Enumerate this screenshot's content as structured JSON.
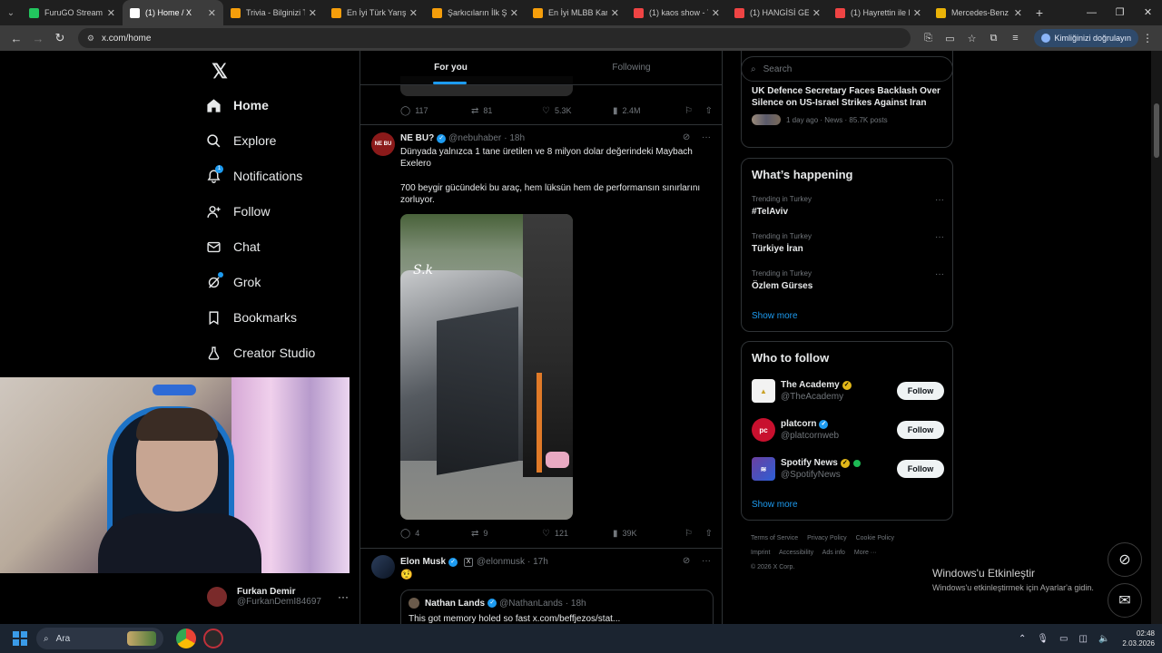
{
  "browser": {
    "tabs": [
      {
        "title": "FuruGO Stream - Y",
        "color": "#22c55e",
        "active": false
      },
      {
        "title": "(1) Home / X",
        "color": "#ffffff",
        "active": true
      },
      {
        "title": "Trivia - Bilginizi Te",
        "color": "#f59e0b",
        "active": false
      },
      {
        "title": "En İyi Türk Yarışm",
        "color": "#f59e0b",
        "active": false
      },
      {
        "title": "Şarkıcıların İlk Şa",
        "color": "#f59e0b",
        "active": false
      },
      {
        "title": "En İyi MLBB Karak",
        "color": "#f59e0b",
        "active": false
      },
      {
        "title": "(1) kaos show - Yo",
        "color": "#ef4444",
        "active": false
      },
      {
        "title": "(1) HANGİSİ GERÇ",
        "color": "#ef4444",
        "active": false
      },
      {
        "title": "(1) Hayrettin ile K",
        "color": "#ef4444",
        "active": false
      },
      {
        "title": "Mercedes-Benz /",
        "color": "#eab308",
        "active": false
      }
    ],
    "url": "x.com/home",
    "verify_label": "Kimliğinizi doğrulayın"
  },
  "nav": {
    "items": [
      {
        "label": "Home",
        "icon": "home-icon"
      },
      {
        "label": "Explore",
        "icon": "search-icon"
      },
      {
        "label": "Notifications",
        "icon": "bell-icon",
        "badge": "1"
      },
      {
        "label": "Follow",
        "icon": "person-plus-icon"
      },
      {
        "label": "Chat",
        "icon": "mail-icon"
      },
      {
        "label": "Grok",
        "icon": "grok-icon"
      },
      {
        "label": "Bookmarks",
        "icon": "bookmark-icon"
      },
      {
        "label": "Creator Studio",
        "icon": "creator-studio-icon"
      }
    ],
    "profile": {
      "name": "Furkan Demir",
      "handle": "@FurkanDemI84697"
    }
  },
  "feed": {
    "tabs": [
      "For you",
      "Following"
    ],
    "prev_post_stats": {
      "replies": "117",
      "reposts": "81",
      "likes": "5.3K",
      "views": "2.4M"
    },
    "post1": {
      "name": "NE BU?",
      "handle": "@nebuhaber",
      "time": "· 18h",
      "avatar_text": "NE BU",
      "text1": "Dünyada yalnızca 1 tane üretilen ve 8 milyon dolar değerindeki Maybach Exelero",
      "text2": "700 beygir gücündeki bu araç, hem lüksün hem de performansın sınırlarını zorluyor.",
      "stats": {
        "replies": "4",
        "reposts": "9",
        "likes": "121",
        "views": "39K"
      }
    },
    "post2": {
      "name": "Elon Musk",
      "handle": "@elonmusk",
      "time": "· 17h",
      "text": "🤨",
      "quote": {
        "name": "Nathan Lands",
        "handle": "@NathanLands",
        "time": "· 18h",
        "text": "This got memory holed so fast x.com/beffjezos/stat..."
      }
    }
  },
  "sidebar": {
    "search_placeholder": "Search",
    "news": {
      "title": "UK Defence Secretary Faces Backlash Over Silence on US-Israel Strikes Against Iran",
      "meta": "1 day ago · News · 85.7K posts"
    },
    "happening": {
      "title": "What’s happening",
      "trends": [
        {
          "context": "Trending in Turkey",
          "name": "#TelAviv"
        },
        {
          "context": "Trending in Turkey",
          "name": "Türkiye İran"
        },
        {
          "context": "Trending in Turkey",
          "name": "Özlem Gürses"
        }
      ],
      "show_more": "Show more"
    },
    "who_to_follow": {
      "title": "Who to follow",
      "accounts": [
        {
          "name": "The Academy",
          "handle": "@TheAcademy",
          "badge": "gold",
          "follow": "Follow"
        },
        {
          "name": "platcorn",
          "handle": "@platcornweb",
          "badge": "blue",
          "follow": "Follow"
        },
        {
          "name": "Spotify News",
          "handle": "@SpotifyNews",
          "badge": "gold",
          "follow": "Follow"
        }
      ],
      "show_more": "Show more"
    },
    "footer": [
      "Terms of Service",
      "Privacy Policy",
      "Cookie Policy",
      "Imprint",
      "Accessibility",
      "Ads info",
      "More ···",
      "© 2026 X Corp."
    ]
  },
  "overlay": {
    "activate_title": "Windows'u Etkinleştir",
    "activate_sub": "Windows'u etkinleştirmek için Ayarlar'a gidin."
  },
  "taskbar": {
    "search": "Ara",
    "time": "02:48",
    "date": "2.03.2026"
  }
}
